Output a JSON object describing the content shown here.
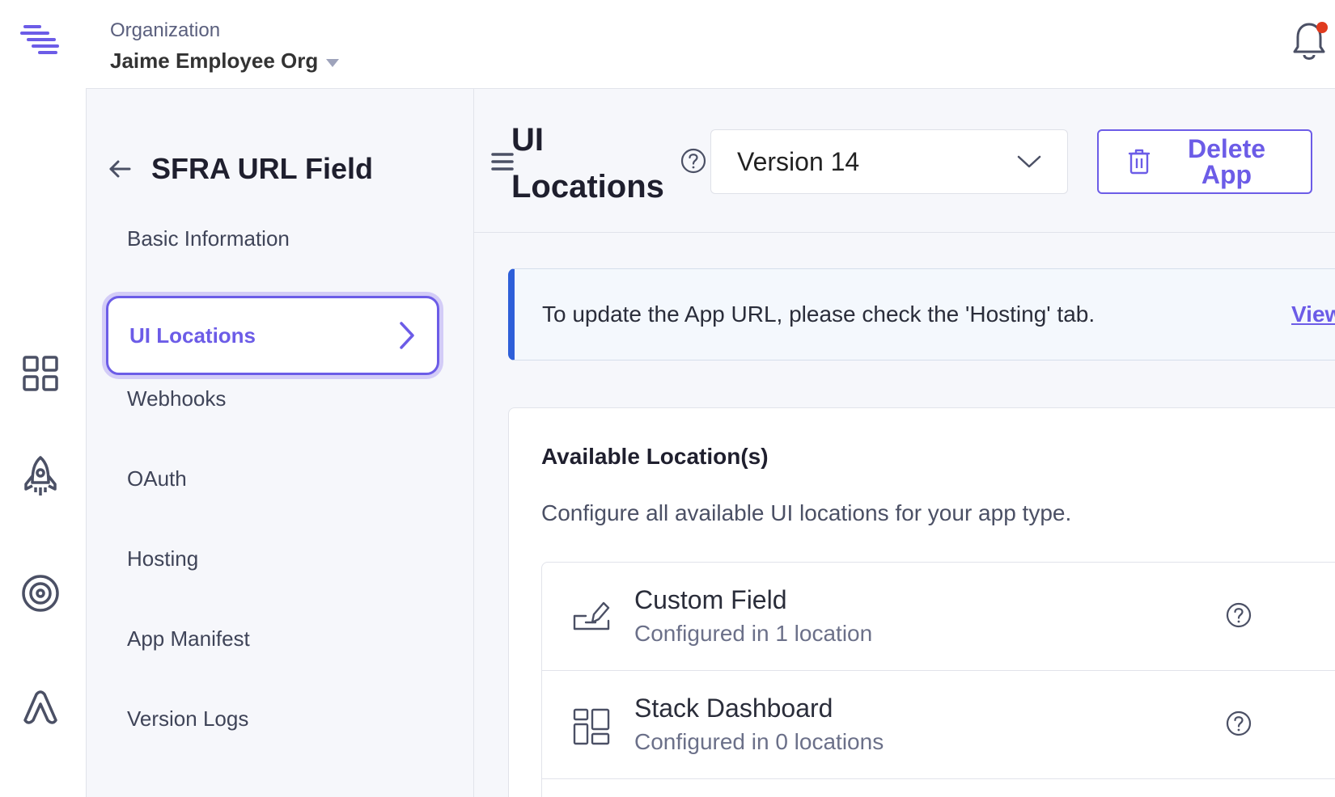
{
  "header": {
    "org_label": "Organization",
    "org_name": "Jaime Employee Org",
    "notification_dot_color": "#e03a1e"
  },
  "rail": {
    "icons": [
      "logo-icon",
      "dashboard-grid-icon",
      "rocket-icon",
      "target-icon",
      "automate-icon"
    ]
  },
  "sidebar": {
    "title": "SFRA URL Field",
    "items": [
      {
        "label": "Basic Information"
      },
      {
        "label": "UI Locations",
        "active": true
      },
      {
        "label": "Webhooks"
      },
      {
        "label": "OAuth"
      },
      {
        "label": "Hosting"
      },
      {
        "label": "App Manifest"
      },
      {
        "label": "Version Logs"
      }
    ]
  },
  "main": {
    "title": "UI Locations",
    "version_select": {
      "value": "Version 14"
    },
    "delete_label": "Delete App",
    "alert": {
      "message": "To update the App URL, please check the 'Hosting' tab.",
      "link": "View"
    },
    "card": {
      "title": "Available Location(s)",
      "description": "Configure all available UI locations for your app type.",
      "locations": [
        {
          "name": "Custom Field",
          "status": "Configured in 1 location",
          "icon": "custom-field-icon"
        },
        {
          "name": "Stack Dashboard",
          "status": "Configured in 0 locations",
          "icon": "stack-dashboard-icon"
        }
      ]
    }
  },
  "colors": {
    "accent": "#6c5ce7",
    "alert_border": "#2e5fd9",
    "surface": "#f6f7fb"
  }
}
